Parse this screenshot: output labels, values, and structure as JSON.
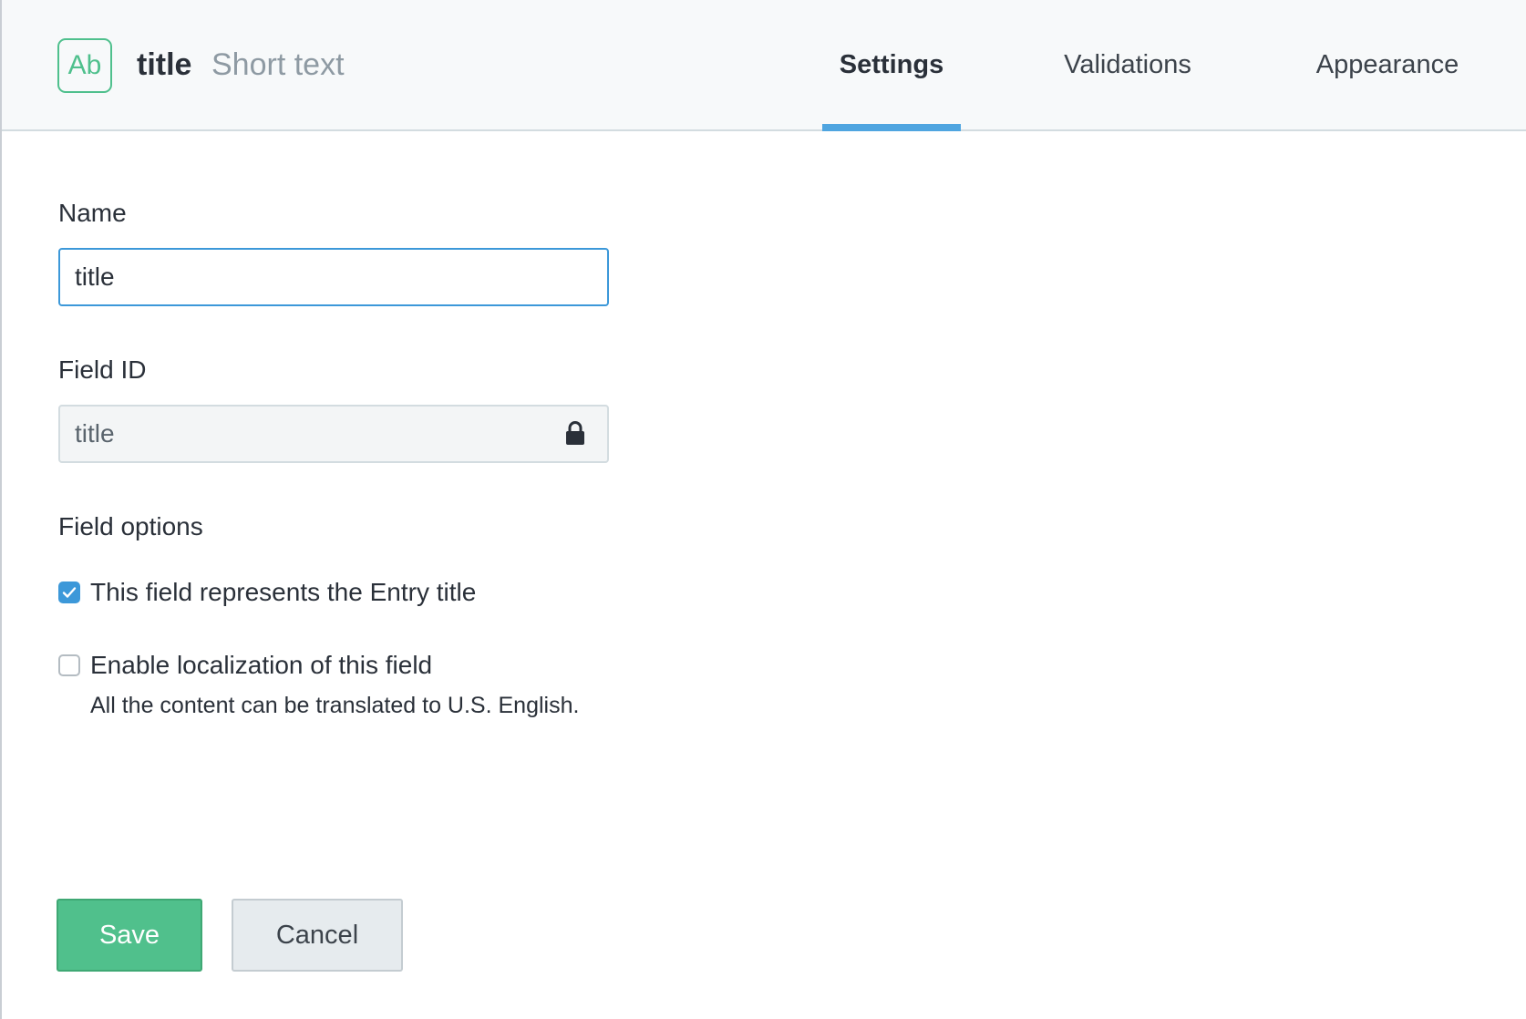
{
  "header": {
    "type_icon_text": "Ab",
    "field_name": "title",
    "field_type": "Short text",
    "accent_color": "#4fc08d"
  },
  "tabs": [
    {
      "label": "Settings",
      "active": true
    },
    {
      "label": "Validations",
      "active": false
    },
    {
      "label": "Appearance",
      "active": false
    }
  ],
  "form": {
    "name_label": "Name",
    "name_value": "title",
    "field_id_label": "Field ID",
    "field_id_value": "title",
    "field_id_icon": "lock-icon",
    "options_label": "Field options",
    "options": [
      {
        "label": "This field represents the Entry title",
        "checked": true
      },
      {
        "label": "Enable localization of this field",
        "checked": false,
        "help": "All the content can be translated to U.S. English."
      }
    ]
  },
  "actions": {
    "save_label": "Save",
    "cancel_label": "Cancel",
    "save_color": "#50c08c"
  },
  "tab_indicator_color": "#4fa5e0"
}
